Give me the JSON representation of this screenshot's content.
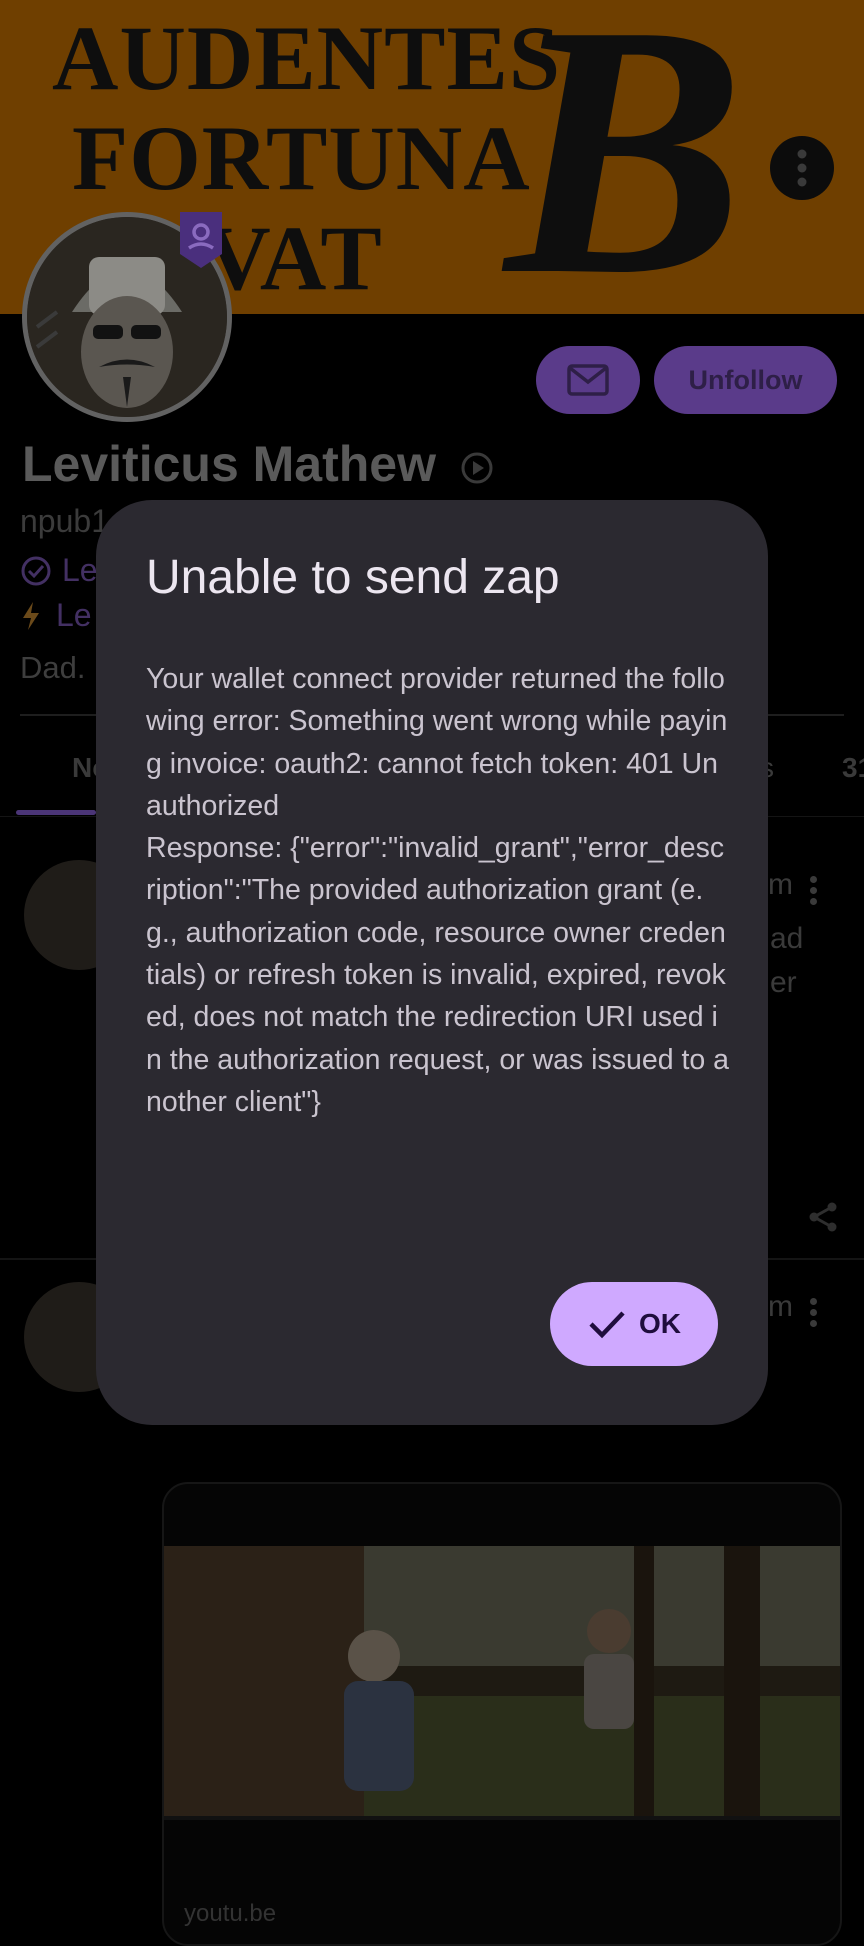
{
  "banner": {
    "line1": "AUDENTES",
    "line2": "FORTUNA",
    "line3": "IUVAT",
    "bitcoin_glyph": "B",
    "color": "#6f3f00",
    "menu_icon": "more-vert-icon"
  },
  "profile": {
    "name": "Leviticus Mathew",
    "npub": "npub1",
    "nip05": "Le",
    "lightning": "Le",
    "about": "Dad.",
    "unfollow_label": "Unfollow",
    "message_icon": "mail-icon",
    "verified_icon": "play-circle-icon"
  },
  "tabs": {
    "notes": "No",
    "right_a": "s",
    "right_b": "31"
  },
  "feed": {
    "post1_time": "m",
    "post1_line1": "ad",
    "post1_line2": "er",
    "post2_time": "m",
    "card_url": "youtu.be"
  },
  "dialog": {
    "title": "Unable to send zap",
    "body": "Your wallet connect provider returned the following error: Something went wrong while paying invoice: oauth2: cannot fetch token: 401 Unauthorized\nResponse: {\"error\":\"invalid_grant\",\"error_description\":\"The provided authorization grant (e.g., authorization code, resource owner credentials) or refresh token is invalid, expired, revoked, does not match the redirection URI used in the authorization request, or was issued to another client\"}",
    "ok_label": "OK",
    "accent": "#cfa9ff"
  }
}
